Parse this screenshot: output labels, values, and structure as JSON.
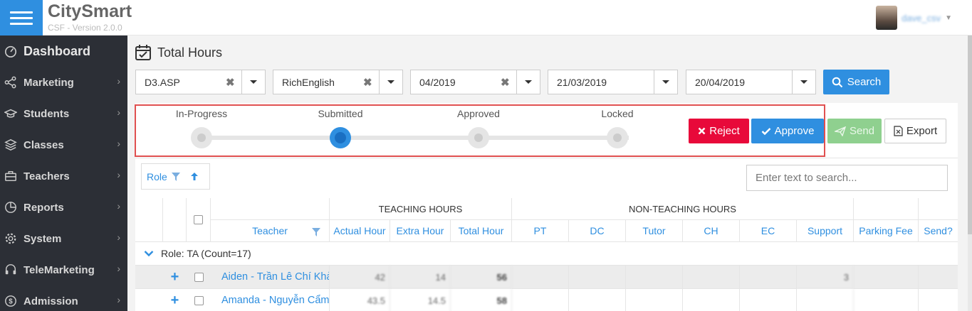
{
  "app": {
    "name": "CitySmart",
    "version": "CSF - Version 2.0.0"
  },
  "user": {
    "name": "dave_csv"
  },
  "sidebar": {
    "items": [
      {
        "label": "Dashboard",
        "icon": "dashboard-icon"
      },
      {
        "label": "Marketing",
        "icon": "share-icon"
      },
      {
        "label": "Students",
        "icon": "graduation-cap-icon"
      },
      {
        "label": "Classes",
        "icon": "layers-icon"
      },
      {
        "label": "Teachers",
        "icon": "briefcase-icon"
      },
      {
        "label": "Reports",
        "icon": "pie-chart-icon"
      },
      {
        "label": "System",
        "icon": "gear-icon"
      },
      {
        "label": "TeleMarketing",
        "icon": "headset-icon"
      },
      {
        "label": "Admission",
        "icon": "dollar-icon"
      }
    ]
  },
  "page": {
    "title": "Total Hours"
  },
  "filters": [
    {
      "value": "D3.ASP",
      "clearable": true
    },
    {
      "value": "RichEnglish",
      "clearable": true
    },
    {
      "value": "04/2019",
      "clearable": true
    },
    {
      "value": "21/03/2019",
      "clearable": false
    },
    {
      "value": "20/04/2019",
      "clearable": false
    }
  ],
  "search_button": {
    "label": "Search"
  },
  "workflow": {
    "steps": [
      "In-Progress",
      "Submitted",
      "Approved",
      "Locked"
    ],
    "active_step": "Submitted"
  },
  "actions": {
    "reject": "Reject",
    "approve": "Approve",
    "send": "Send",
    "export": "Export"
  },
  "grouping": {
    "label": "Role"
  },
  "table_search": {
    "placeholder": "Enter text to search..."
  },
  "table": {
    "group_headers": {
      "teaching": "TEACHING HOURS",
      "non_teaching": "NON-TEACHING HOURS"
    },
    "columns": {
      "teacher": "Teacher",
      "actual_hour": "Actual Hour",
      "extra_hour": "Extra Hour",
      "total_hour": "Total Hour",
      "pt": "PT",
      "dc": "DC",
      "tutor": "Tutor",
      "ch": "CH",
      "ec": "EC",
      "support": "Support",
      "parking_fee": "Parking Fee",
      "send": "Send?"
    },
    "group_row": "Role: TA (Count=17)",
    "rows": [
      {
        "teacher": "Aiden - Trần Lê Chí Khả",
        "actual_hour": "42",
        "extra_hour": "14",
        "total_hour": "56",
        "support": "3"
      },
      {
        "teacher": "Amanda - Nguyễn Cẩm",
        "actual_hour": "43.5",
        "extra_hour": "14.5",
        "total_hour": "58",
        "support": ""
      }
    ]
  },
  "colors": {
    "primary": "#2f8fe0",
    "reject": "#e8093a",
    "send": "#8fd08f",
    "sidebar": "#2c2f36",
    "highlight": "#e05050"
  }
}
